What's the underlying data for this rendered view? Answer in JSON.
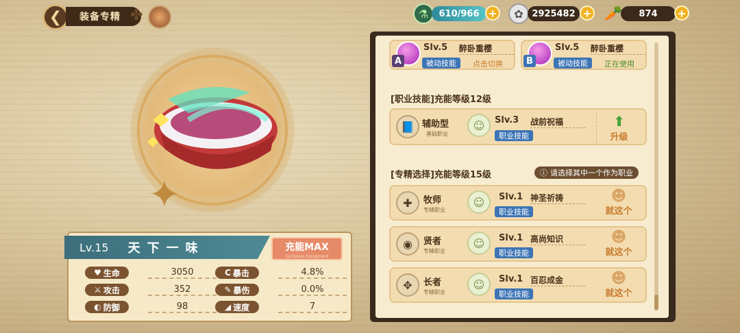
{
  "header": {
    "title": "装备专精",
    "resources": {
      "stamina": "610/966",
      "coins": "2925482",
      "carrots": "874"
    }
  },
  "equipment": {
    "level": "Lv.15",
    "name": "天下一味",
    "badge": "充能MAX",
    "badge_sub": "Exclusive Equipment",
    "stats_left": [
      {
        "label": "生命",
        "icon": "heart-icon",
        "value": "3050"
      },
      {
        "label": "攻击",
        "icon": "sword-icon",
        "value": "352"
      },
      {
        "label": "防御",
        "icon": "shield-icon",
        "value": "98"
      }
    ],
    "stats_right": [
      {
        "label": "暴击",
        "icon": "crit-icon",
        "value": "4.8%"
      },
      {
        "label": "暴伤",
        "icon": "crit-damage-icon",
        "value": "0.0%"
      },
      {
        "label": "速度",
        "icon": "boot-icon",
        "value": "7"
      }
    ]
  },
  "skills_top": [
    {
      "slot": "A",
      "level": "Slv.5",
      "name": "醉卧重樱",
      "type": "被动技能",
      "action": "点击切换"
    },
    {
      "slot": "B",
      "level": "Slv.5",
      "name": "醉卧重樱",
      "type": "被动技能",
      "action": "正在使用"
    }
  ],
  "job_section": {
    "title": "[职业技能]充能等级12级",
    "class_name": "辅助型",
    "class_sub": "基础职业",
    "level": "Slv.3",
    "skill_name": "战前祝福",
    "skill_type": "职业技能",
    "upgrade_label": "升级"
  },
  "spec_section": {
    "title": "[专精选择]充能等级15级",
    "hint": "请选择其中一个作为职业",
    "options": [
      {
        "class_name": "牧师",
        "class_sub": "专精职业",
        "level": "Slv.1",
        "skill_name": "神圣祈祷",
        "skill_type": "职业技能",
        "pick_label": "就这个"
      },
      {
        "class_name": "贤者",
        "class_sub": "专精职业",
        "level": "Slv.1",
        "skill_name": "高尚知识",
        "skill_type": "职业技能",
        "pick_label": "就这个"
      },
      {
        "class_name": "长者",
        "class_sub": "专精职业",
        "level": "Slv.1",
        "skill_name": "百忍成金",
        "skill_type": "职业技能",
        "pick_label": "就这个"
      }
    ]
  }
}
